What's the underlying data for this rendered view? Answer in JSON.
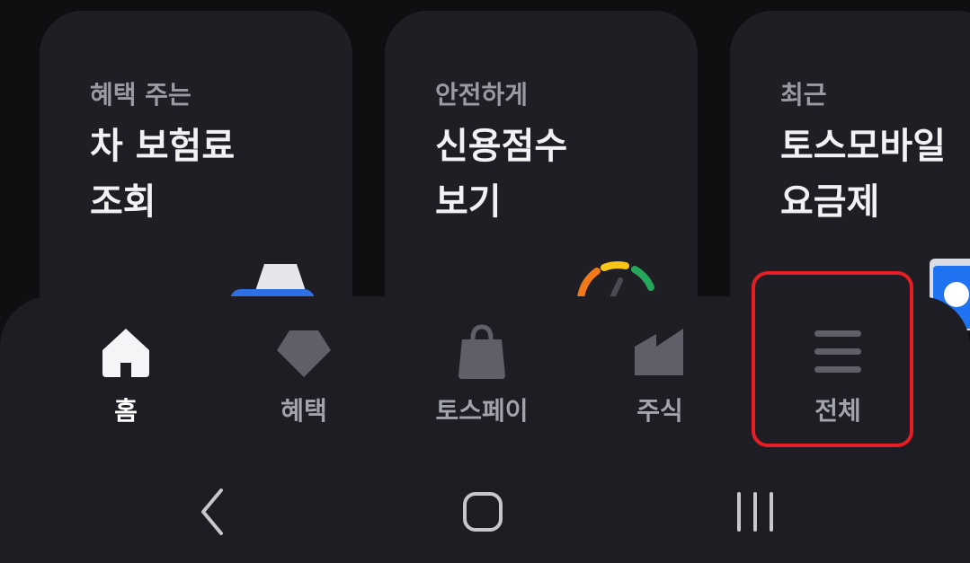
{
  "cards": [
    {
      "subtitle": "혜택 주는",
      "title_line1": "차 보험료",
      "title_line2": "조회"
    },
    {
      "subtitle": "안전하게",
      "title_line1": "신용점수",
      "title_line2": "보기"
    },
    {
      "subtitle": "최근",
      "title_line1": "토스모바일",
      "title_line2": "요금제"
    }
  ],
  "tabs": [
    {
      "label": "홈",
      "icon": "home-icon",
      "active": true
    },
    {
      "label": "혜택",
      "icon": "diamond-icon",
      "active": false
    },
    {
      "label": "토스페이",
      "icon": "shopping-bag-icon",
      "active": false
    },
    {
      "label": "주식",
      "icon": "chart-icon",
      "active": false
    },
    {
      "label": "전체",
      "icon": "hamburger-menu-icon",
      "active": false
    }
  ],
  "system_nav": {
    "back": "back-icon",
    "home": "home-button-icon",
    "recents": "recents-icon"
  },
  "colors": {
    "accent_highlight": "#e51e26",
    "active_tab": "#ffffff",
    "inactive_tab": "#a3a3ad"
  }
}
